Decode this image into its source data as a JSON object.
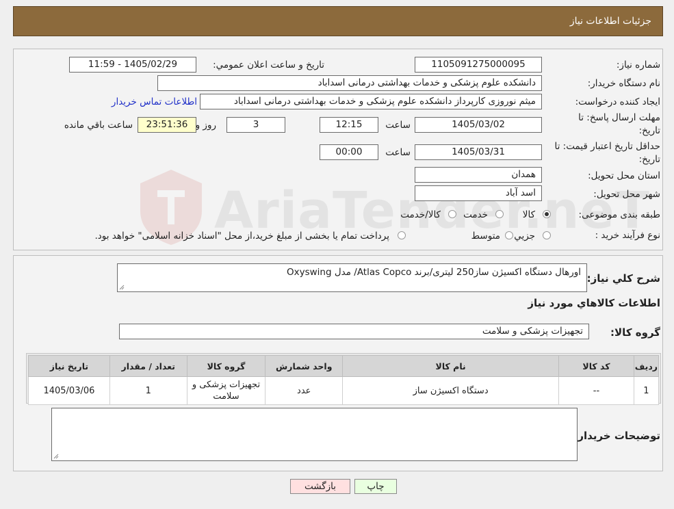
{
  "header": {
    "title": "جزئیات اطلاعات نیاز"
  },
  "info": {
    "need_number": {
      "label": "شماره نیاز:",
      "value": "1105091275000095"
    },
    "announce": {
      "label": "تاریخ و ساعت اعلان عمومي:",
      "value": "1405/02/29 - 11:59"
    },
    "buyer_org": {
      "label": "نام دستگاه خريدار:",
      "value": "دانشکده علوم پزشکی و خدمات بهداشتی درمانی اسداباد"
    },
    "requester": {
      "label": "ايجاد کننده درخواست:",
      "value": "میثم نوروزی کارپرداز دانشکده علوم پزشکی و خدمات بهداشتی درمانی اسداباد",
      "contact_link": "اطلاعات تماس خريدار"
    },
    "reply_deadline": {
      "label_line1": "مهلت ارسال پاسخ: تا",
      "label_line2": "تاريخ:",
      "date": "1405/03/02",
      "time_label": "ساعت",
      "time": "12:15",
      "days": "3",
      "days_label": "روز و",
      "remaining": "23:51:36",
      "remaining_label": "ساعت باقي مانده"
    },
    "price_validity": {
      "label_line1": "حداقل تاريخ اعتبار قيمت: تا",
      "label_line2": "تاريخ:",
      "date": "1405/03/31",
      "time_label": "ساعت",
      "time": "00:00"
    },
    "province": {
      "label": "استان محل تحويل:",
      "value": "همدان"
    },
    "city": {
      "label": "شهر محل تحويل:",
      "value": "اسد آباد"
    },
    "category": {
      "label": "طبقه بندی موضوعی:",
      "options": [
        "کالا",
        "خدمت",
        "کالا/خدمت"
      ],
      "selected": 0
    },
    "process": {
      "label": "نوع فرآيند خريد :",
      "options": [
        "جزيي",
        "متوسط"
      ],
      "note": "پرداخت تمام يا بخشی از مبلغ خريد،از محل \"اسناد خزانه اسلامی\" خواهد بود."
    }
  },
  "description": {
    "label": "شرح کلي نياز:",
    "value": "اورهال دستگاه اکسیژن ساز250 لیتری/برند Atlas Copco/ مدل Oxyswing"
  },
  "goods_info_title": "اطلاعات کالاهاي مورد نياز",
  "goods_group": {
    "label": "گروه کالا:",
    "value": "تجهیزات پزشکی و سلامت"
  },
  "table": {
    "headers": [
      "رديف",
      "کد کالا",
      "نام کالا",
      "واحد شمارش",
      "گروه کالا",
      "تعداد / مقدار",
      "تاريخ نياز"
    ],
    "rows": [
      [
        "1",
        "--",
        "دستگاه اکسیژن ساز",
        "عدد",
        "تجهیزات پزشکی و سلامت",
        "1",
        "1405/03/06"
      ]
    ]
  },
  "buyer_notes": {
    "label": "توضيحات خريدار:",
    "value": ""
  },
  "buttons": {
    "print": "چاپ",
    "back": "بازگشت"
  },
  "watermark": {
    "text": "AriaTender.neT"
  },
  "colors": {
    "header": "#8c6a3c",
    "link": "#2030c8",
    "print_btn": "#e9ffe0",
    "back_btn": "#ffe0e0",
    "remaining_bg": "#ffffcc"
  }
}
